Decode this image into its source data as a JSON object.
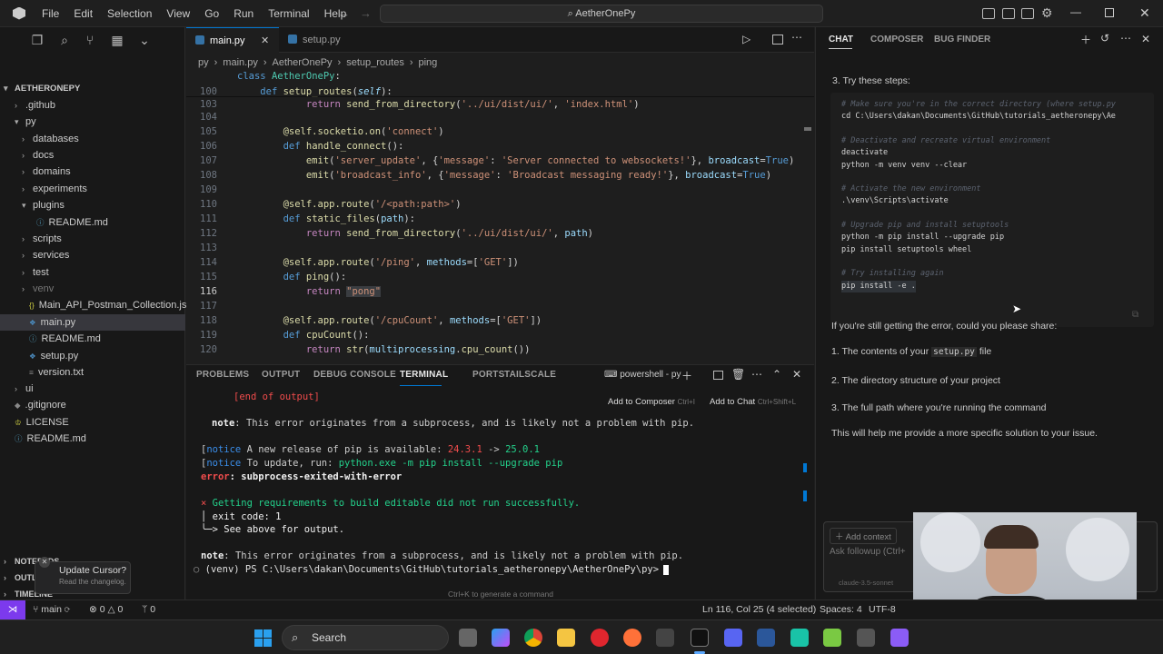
{
  "menu": [
    "File",
    "Edit",
    "Selection",
    "View",
    "Go",
    "Run",
    "Terminal",
    "Help"
  ],
  "command_center": "AetherOnePy",
  "tabs": [
    {
      "label": "main.py"
    },
    {
      "label": "setup.py"
    }
  ],
  "breadcrumb": [
    "py",
    "main.py",
    "AetherOnePy",
    "setup_routes",
    "ping"
  ],
  "explorer": {
    "root": "AETHERONEPY",
    "items": [
      ".github",
      "py",
      "databases",
      "docs",
      "domains",
      "experiments",
      "plugins",
      "README.md",
      "scripts",
      "services",
      "test",
      "venv",
      "Main_API_Postman_Collection.json",
      "main.py",
      "README.md",
      "setup.py",
      "version.txt",
      "ui",
      ".gitignore",
      "LICENSE",
      "README.md"
    ],
    "sections": [
      "NOTEPADS",
      "OUTLINE",
      "TIMELINE"
    ]
  },
  "update": {
    "title": "Update Cursor?",
    "subtitle": "Read the changelog."
  },
  "editor": {
    "lines": [
      {
        "n": "",
        "t": "class AetherOnePy:"
      },
      {
        "n": "100",
        "t": "    def setup_routes(self):"
      },
      {
        "n": "103",
        "t": "            return send_from_directory('../ui/dist/ui/', 'index.html')"
      },
      {
        "n": "104",
        "t": ""
      },
      {
        "n": "105",
        "t": "        @self.socketio.on('connect')"
      },
      {
        "n": "106",
        "t": "        def handle_connect():"
      },
      {
        "n": "107",
        "t": "            emit('server_update', {'message': 'Server connected to websockets!'}, broadcast=True)"
      },
      {
        "n": "108",
        "t": "            emit('broadcast_info', {'message': 'Broadcast messaging ready!'}, broadcast=True)"
      },
      {
        "n": "109",
        "t": ""
      },
      {
        "n": "110",
        "t": "        @self.app.route('/<path:path>')"
      },
      {
        "n": "111",
        "t": "        def static_files(path):"
      },
      {
        "n": "112",
        "t": "            return send_from_directory('../ui/dist/ui/', path)"
      },
      {
        "n": "113",
        "t": ""
      },
      {
        "n": "114",
        "t": "        @self.app.route('/ping', methods=['GET'])"
      },
      {
        "n": "115",
        "t": "        def ping():"
      },
      {
        "n": "116",
        "t": "            return \"pong\""
      },
      {
        "n": "117",
        "t": ""
      },
      {
        "n": "118",
        "t": "        @self.app.route('/cpuCount', methods=['GET'])"
      },
      {
        "n": "119",
        "t": "        def cpuCount():"
      },
      {
        "n": "120",
        "t": "            return str(multiprocessing.cpu_count())"
      }
    ]
  },
  "panel": {
    "tabs": [
      "PROBLEMS",
      "OUTPUT",
      "DEBUG CONSOLE",
      "TERMINAL",
      "PORTS",
      "TAILSCALE"
    ],
    "shell": "powershell - py",
    "add_composer": "Add to Composer",
    "add_composer_key": "Ctrl+I",
    "add_chat": "Add to Chat",
    "add_chat_key": "Ctrl+Shift+L",
    "lines": [
      "[end of output]",
      "note: This error originates from a subprocess, and is likely not a problem with pip.",
      "[notice] A new release of pip is available: 24.3.1 -> 25.0.1",
      "[notice] To update, run: python.exe -m pip install --upgrade pip",
      "error: subprocess-exited-with-error",
      "× Getting requirements to build editable did not run successfully.",
      "│ exit code: 1",
      "╰─> See above for output.",
      "note: This error originates from a subprocess, and is likely not a problem with pip.",
      "(venv) PS C:\\Users\\dakan\\Documents\\GitHub\\tutorials_aetheronepy\\AetherOnePy\\py>"
    ],
    "hint": "Ctrl+K to generate a command"
  },
  "chat": {
    "tabs": [
      "CHAT",
      "COMPOSER",
      "BUG FINDER"
    ],
    "step": "3. Try these steps:",
    "code": [
      "# Make sure you're in the correct directory (where setup.py",
      "cd C:\\Users\\dakan\\Documents\\GitHub\\tutorials_aetheronepy\\Ae",
      "",
      "# Deactivate and recreate virtual environment",
      "deactivate",
      "python -m venv venv --clear",
      "",
      "# Activate the new environment",
      ".\\venv\\Scripts\\activate",
      "",
      "# Upgrade pip and install setuptools",
      "python -m pip install --upgrade pip",
      "pip install setuptools wheel",
      "",
      "# Try installing again",
      "pip install -e ."
    ],
    "p1": "If you're still getting the error, could you please share:",
    "li1a": "1. The contents of your",
    "li1code": "setup.py",
    "li1b": "file",
    "li2": "2. The directory structure of your project",
    "li3": "3. The full path where you're running the command",
    "p2": "This will help me provide a more specific solution to your issue.",
    "add_context": "Add context",
    "input_placeholder": "Ask followup (Ctrl+",
    "model": "claude-3.5-sonnet"
  },
  "status": {
    "branch": "main",
    "errors": "0",
    "warnings": "0",
    "ports": "0",
    "position": "Ln 116, Col 25 (4 selected)",
    "spaces": "Spaces: 4",
    "encoding": "UTF-8"
  },
  "taskbar": {
    "search": "Search"
  },
  "colors": {
    "accent": "#0078d4",
    "remote": "#7c3aed"
  }
}
